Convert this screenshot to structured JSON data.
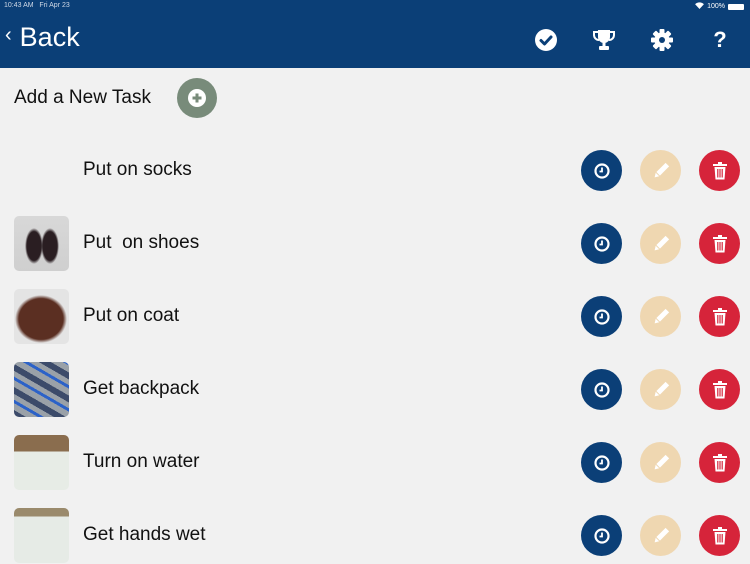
{
  "status_bar": {
    "time": "10:43 AM",
    "date": "Fri Apr 23",
    "battery": "100%"
  },
  "header": {
    "back_label": "Back",
    "icons": [
      "checkmark-circle-icon",
      "trophy-icon",
      "gear-icon",
      "question-icon"
    ]
  },
  "add_task": {
    "label": "Add a New Task",
    "button_icon": "plus-circle-icon"
  },
  "colors": {
    "header": "#0b3f77",
    "add": "#788b7a",
    "timer": "#0b3f77",
    "edit": "#efd7b1",
    "delete": "#d6243a"
  },
  "tasks": [
    {
      "label": "Put on socks",
      "image": "socks-photo"
    },
    {
      "label": "Put  on shoes",
      "image": "shoes-photo"
    },
    {
      "label": "Put on coat",
      "image": "coat-photo"
    },
    {
      "label": "Get backpack",
      "image": "backpack-photo"
    },
    {
      "label": "Turn on water",
      "image": "faucet-photo"
    },
    {
      "label": "Get hands wet",
      "image": "wet-hands-photo"
    }
  ]
}
